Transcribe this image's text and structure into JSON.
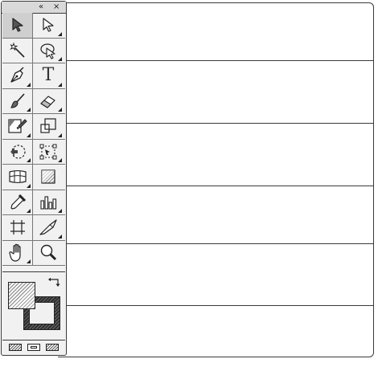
{
  "toolbox": {
    "titlebar": {
      "collapse_glyph": "«",
      "close_glyph": "×"
    },
    "tools": [
      [
        "selection-tool-icon",
        "direct-selection-tool-icon"
      ],
      [
        "magic-wand-tool-icon",
        "lasso-tool-icon"
      ],
      [
        "pen-tool-icon",
        "type-tool-icon"
      ],
      [
        "paintbrush-tool-icon",
        "eraser-tool-icon"
      ],
      [
        "live-paint-bucket-tool-icon",
        "scale-tool-icon"
      ],
      [
        "rotate-tool-icon",
        "free-transform-tool-icon"
      ],
      [
        "mesh-tool-icon",
        "gradient-tool-icon"
      ],
      [
        "eyedropper-tool-icon",
        "graph-tool-icon"
      ],
      [
        "artboard-tool-icon",
        "knife-tool-icon"
      ],
      [
        "hand-tool-icon",
        "zoom-tool-icon"
      ]
    ],
    "type_tool_glyph": "T",
    "color": {
      "fill": "striped-light",
      "stroke": "striped-dark"
    },
    "screen_modes": [
      "normal-screen-mode-icon",
      "full-screen-with-menu-icon",
      "full-screen-mode-icon"
    ]
  },
  "content_panel": {
    "rows": 6
  },
  "colors": {
    "outline": "#3a3a3a",
    "panel_bg": "#f1f1f1",
    "selected_bg": "#cfcfcf"
  }
}
